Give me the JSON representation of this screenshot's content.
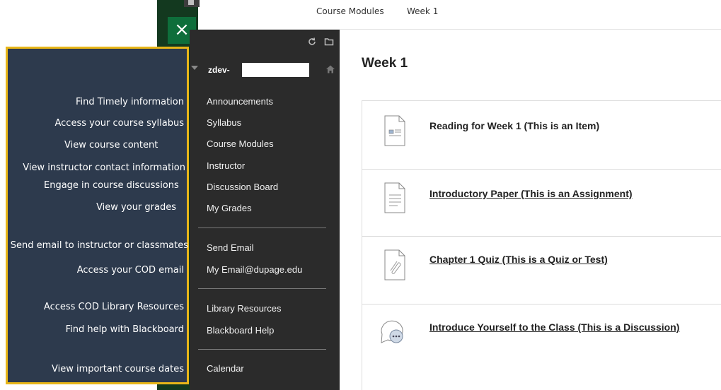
{
  "breadcrumb": {
    "items": [
      "Course Modules",
      "Week 1"
    ]
  },
  "close_label": "×",
  "course": {
    "name": "zdev-"
  },
  "menu": {
    "items": [
      "Announcements",
      "Syllabus",
      "Course Modules",
      "Instructor",
      "Discussion Board",
      "My Grades",
      "Send Email",
      "My Email@dupage.edu",
      "Library Resources",
      "Blackboard Help",
      "Calendar"
    ]
  },
  "help_panel": {
    "hints": [
      "Find Timely information",
      "Access your course syllabus",
      "View course content",
      "View instructor contact information",
      "Engage in course discussions",
      "View your grades",
      "Send email to instructor or classmates",
      "Access your COD email",
      "Access COD Library Resources",
      "Find help with Blackboard",
      "View important course dates"
    ]
  },
  "page": {
    "title": "Week 1"
  },
  "content": {
    "items": [
      {
        "title": "Reading for Week 1 (This is an Item)",
        "icon": "document-icon"
      },
      {
        "title": "Introductory Paper (This is an Assignment)",
        "icon": "assignment-icon"
      },
      {
        "title": "Chapter 1 Quiz (This is a Quiz or Test)",
        "icon": "quiz-icon"
      },
      {
        "title": "Introduce Yourself to the Class (This is a Discussion)",
        "icon": "discussion-icon"
      }
    ]
  },
  "colors": {
    "help_panel_bg": "#2d3a4d",
    "help_panel_border": "#e8b619",
    "menu_bg": "#2b2b2b",
    "close_bg": "#0e6e3b",
    "strip_bg": "#13391f"
  }
}
